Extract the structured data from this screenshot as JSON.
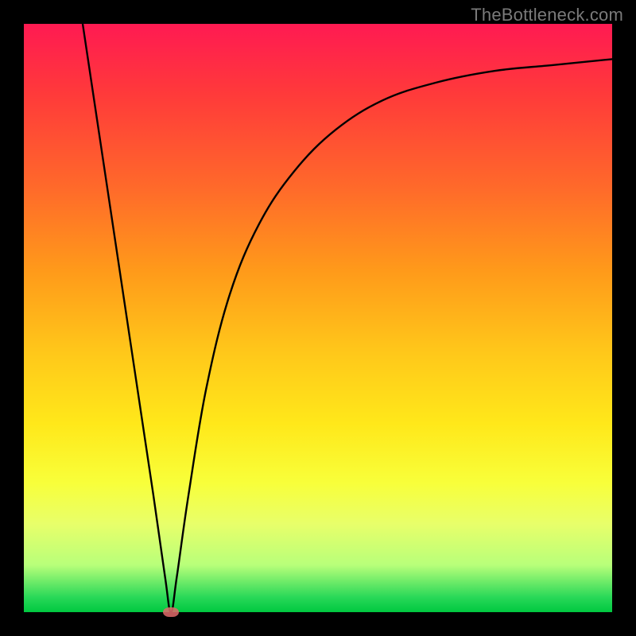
{
  "watermark": "TheBottleneck.com",
  "colors": {
    "frame": "#000000",
    "curve": "#000000",
    "marker": "#e06a6a"
  },
  "chart_data": {
    "type": "line",
    "title": "",
    "xlabel": "",
    "ylabel": "",
    "xlim": [
      0,
      100
    ],
    "ylim": [
      0,
      100
    ],
    "grid": false,
    "legend": false,
    "notes": "Background is a vertical gradient from red (top, high bottleneck) through yellow to green (bottom, no bottleneck). Curve plots relative bottleneck vs. an x-parameter; minimum near x≈25. No numeric axis ticks are shown; values are estimated from geometry.",
    "series": [
      {
        "name": "bottleneck-curve",
        "x": [
          10,
          13,
          16,
          19,
          22,
          24,
          25,
          26,
          28,
          31,
          35,
          40,
          46,
          53,
          61,
          70,
          80,
          90,
          100
        ],
        "values": [
          100,
          80,
          60,
          40,
          20,
          6,
          0,
          6,
          20,
          38,
          54,
          66,
          75,
          82,
          87,
          90,
          92,
          93,
          94
        ]
      }
    ],
    "marker": {
      "x": 25,
      "y": 0
    },
    "gradient_stops": [
      {
        "pos": 0,
        "color": "#ff1a52"
      },
      {
        "pos": 28,
        "color": "#ff6a2a"
      },
      {
        "pos": 56,
        "color": "#ffc81a"
      },
      {
        "pos": 78,
        "color": "#f8ff3a"
      },
      {
        "pos": 100,
        "color": "#00c840"
      }
    ]
  }
}
